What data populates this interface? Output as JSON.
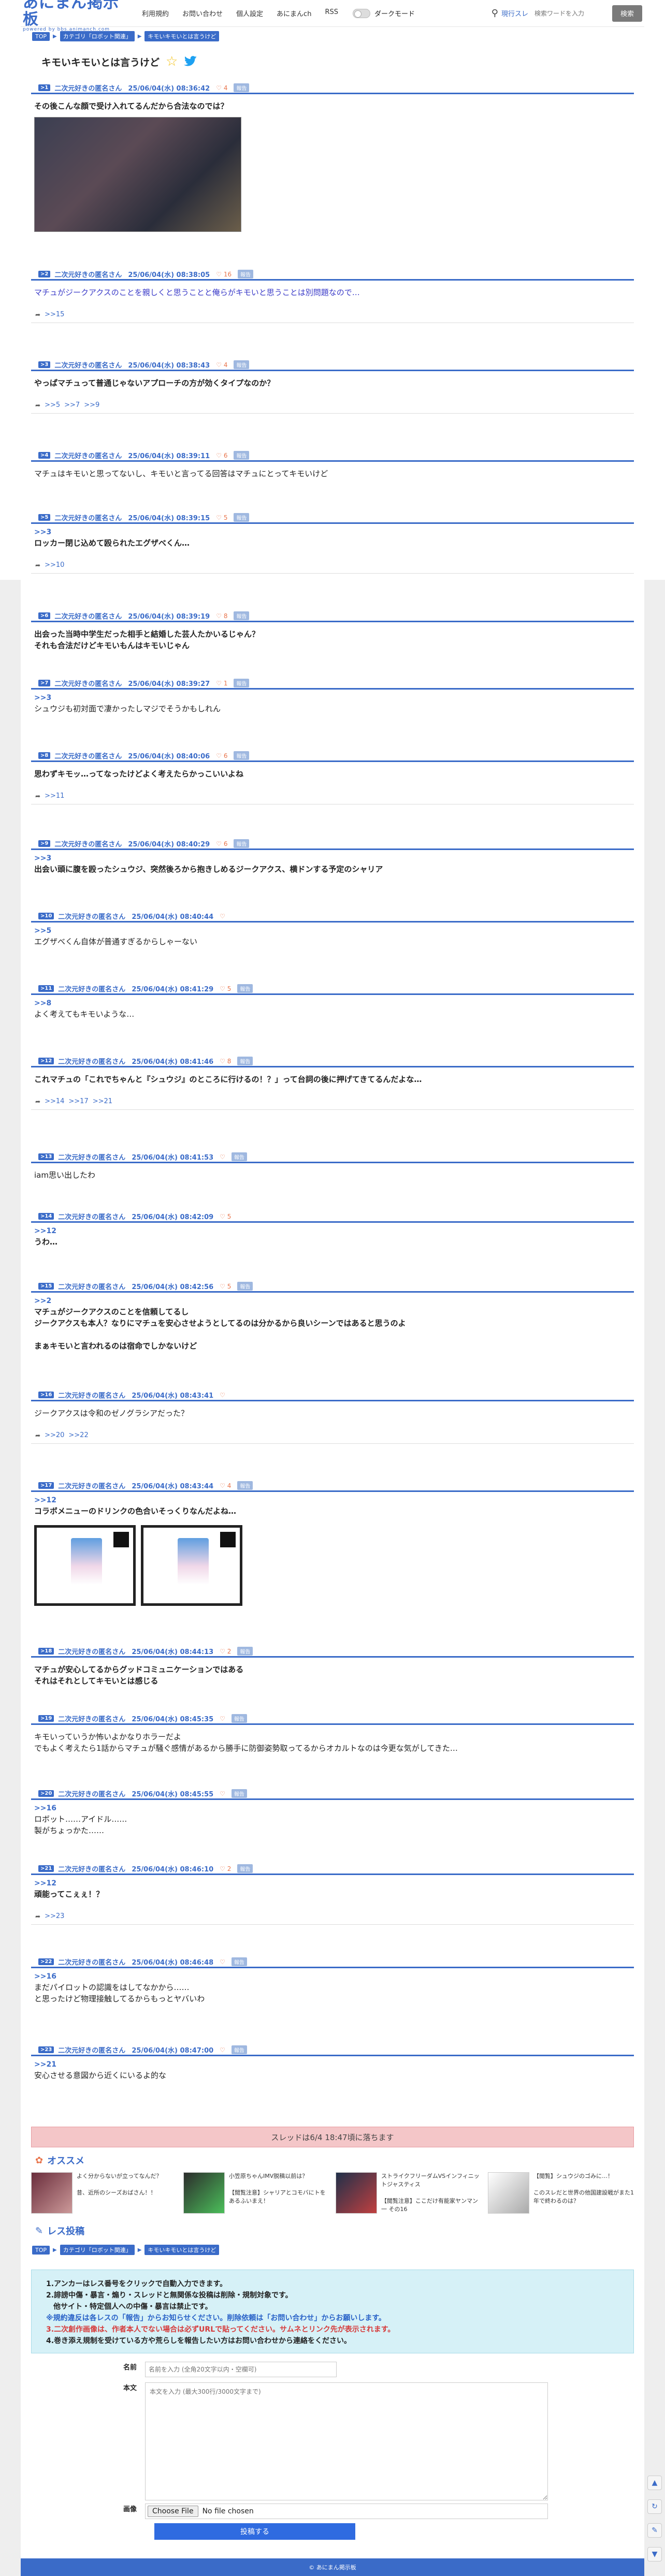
{
  "site": {
    "logo": "あにまん掲示板",
    "logo_sub": "powered by bbs.animanch.com",
    "nav": [
      "利用規約",
      "お問い合わせ",
      "個人設定",
      "あにまんch",
      "RSS"
    ],
    "dark_mode": "ダークモード",
    "search_scope": "現行スレ",
    "search_placeholder": "検索ワードを入力",
    "search_button": "検索"
  },
  "breadcrumb": [
    "TOP",
    "カテゴリ「ロボット関連」",
    "キモいキモいとは言うけど"
  ],
  "thread": {
    "title": "キモいキモいとは言うけど"
  },
  "posts": [
    {
      "num": ">1",
      "name": "二次元好きの匿名さん",
      "date": "25/06/04(水) 08:36:42",
      "likes": "4",
      "report": "報告",
      "body": "その後こんな顔で受け入れてるんだから合法なのでは？",
      "bold": true,
      "has_image": true
    },
    {
      "num": ">2",
      "name": "二次元好きの匿名さん",
      "date": "25/06/04(水) 08:38:05",
      "likes": "16",
      "report": "報告",
      "body": "マチュがジークアクスのことを親しくと思うことと俺らがキモいと思うことは別問題なので…",
      "replies": [
        ">>15"
      ]
    },
    {
      "num": ">3",
      "name": "二次元好きの匿名さん",
      "date": "25/06/04(水) 08:38:43",
      "likes": "4",
      "report": "報告",
      "body": "やっぱマチュって普通じゃないアプローチの方が効くタイプなのか？",
      "bold": true,
      "replies": [
        ">>5",
        ">>7",
        ">>9"
      ]
    },
    {
      "num": ">4",
      "name": "二次元好きの匿名さん",
      "date": "25/06/04(水) 08:39:11",
      "likes": "6",
      "report": "報告",
      "body": "マチュはキモいと思ってないし、キモいと言ってる回答はマチュにとってキモいけど"
    },
    {
      "num": ">5",
      "name": "二次元好きの匿名さん",
      "date": "25/06/04(水) 08:39:15",
      "likes": "5",
      "report": "報告",
      "anchor": ">>3",
      "body": "ロッカー閉じ込めて殴られたエグザべくん…",
      "bold": true,
      "replies": [
        ">>10"
      ]
    },
    {
      "num": ">6",
      "name": "二次元好きの匿名さん",
      "date": "25/06/04(水) 08:39:19",
      "likes": "8",
      "report": "報告",
      "body": "出会った当時中学生だった相手と結婚した芸人たかいるじゃん？\nそれも合法だけどキモいもんはキモいじゃん",
      "bold": true
    },
    {
      "num": ">7",
      "name": "二次元好きの匿名さん",
      "date": "25/06/04(水) 08:39:27",
      "likes": "1",
      "report": "報告",
      "anchor": ">>3",
      "body": "シュウジも初対面で凄かったしマジでそうかもしれん"
    },
    {
      "num": ">8",
      "name": "二次元好きの匿名さん",
      "date": "25/06/04(水) 08:40:06",
      "likes": "6",
      "report": "報告",
      "body": "思わずキモッ…ってなったけどよく考えたらかっこいいよね",
      "bold": true,
      "replies": [
        ">>11"
      ]
    },
    {
      "num": ">9",
      "name": "二次元好きの匿名さん",
      "date": "25/06/04(水) 08:40:29",
      "likes": "6",
      "report": "報告",
      "anchor": ">>3",
      "body": "出会い頭に腹を殴ったシュウジ、突然後ろから抱きしめるジークアクス、横ドンする予定のシャリア",
      "bold": true
    },
    {
      "num": ">10",
      "name": "二次元好きの匿名さん",
      "date": "25/06/04(水) 08:40:44",
      "likes": "",
      "report": "",
      "anchor": ">>5",
      "body": "エグザべくん自体が普通すぎるからしゃーない"
    },
    {
      "num": ">11",
      "name": "二次元好きの匿名さん",
      "date": "25/06/04(水) 08:41:29",
      "likes": "5",
      "report": "報告",
      "anchor": ">>8",
      "body": "よく考えてもキモいような…"
    },
    {
      "num": ">12",
      "name": "二次元好きの匿名さん",
      "date": "25/06/04(水) 08:41:46",
      "likes": "8",
      "report": "報告",
      "body": "これマチュの「これでちゃんと『シュウジ』のところに行けるの！？」って台詞の後に押げてきてるんだよな…",
      "bold": true,
      "replies": [
        ">>14",
        ">>17",
        ">>21"
      ]
    },
    {
      "num": ">13",
      "name": "二次元好きの匿名さん",
      "date": "25/06/04(水) 08:41:53",
      "likes": "",
      "report": "報告",
      "body": "iam思い出したわ"
    },
    {
      "num": ">14",
      "name": "二次元好きの匿名さん",
      "date": "25/06/04(水) 08:42:09",
      "likes": "5",
      "report": "",
      "anchor": ">>12",
      "body": "うわ…",
      "bold": true
    },
    {
      "num": ">15",
      "name": "二次元好きの匿名さん",
      "date": "25/06/04(水) 08:42:56",
      "likes": "5",
      "report": "報告",
      "anchor": ">>2",
      "body": "マチュがジークアクスのことを信頼してるし\nジークアクスも本人？なりにマチュを安心させようとしてるのは分かるから良いシーンではあると思うのよ\n\nまぁキモいと言われるのは宿命でしかないけど",
      "bold": true
    },
    {
      "num": ">16",
      "name": "二次元好きの匿名さん",
      "date": "25/06/04(水) 08:43:41",
      "likes": "",
      "report": "",
      "body": "ジークアクスは令和のゼノグラシアだった？",
      "replies": [
        ">>20",
        ">>22"
      ]
    },
    {
      "num": ">17",
      "name": "二次元好きの匿名さん",
      "date": "25/06/04(水) 08:43:44",
      "likes": "4",
      "report": "報告",
      "anchor": ">>12",
      "body": "コラボメニューのドリンクの色合いそっくりなんだよね…",
      "bold": true,
      "has_drinks": true
    },
    {
      "num": ">18",
      "name": "二次元好きの匿名さん",
      "date": "25/06/04(水) 08:44:13",
      "likes": "2",
      "report": "報告",
      "body": "マチュが安心してるからグッドコミュニケーションではある\nそれはそれとしてキモいとは感じる",
      "bold": true
    },
    {
      "num": ">19",
      "name": "二次元好きの匿名さん",
      "date": "25/06/04(水) 08:45:35",
      "likes": "",
      "report": "報告",
      "body": "キモいっていうか怖いよかなりホラーだよ\nでもよく考えたら1話からマチュが騒ぐ感情があるから勝手に防御姿勢取ってるからオカルトなのは今更な気がしてきた…"
    },
    {
      "num": ">20",
      "name": "二次元好きの匿名さん",
      "date": "25/06/04(水) 08:45:55",
      "likes": "",
      "report": "報告",
      "anchor": ">>16",
      "body": "ロボット……アイドル……\n製がちょっかた……"
    },
    {
      "num": ">21",
      "name": "二次元好きの匿名さん",
      "date": "25/06/04(水) 08:46:10",
      "likes": "2",
      "report": "報告",
      "anchor": ">>12",
      "body": "頑能ってこぇぇ！？",
      "bold": true,
      "replies": [
        ">>23"
      ]
    },
    {
      "num": ">22",
      "name": "二次元好きの匿名さん",
      "date": "25/06/04(水) 08:46:48",
      "likes": "",
      "report": "報告",
      "anchor": ">>16",
      "body": "まだパイロットの認識をはしてなかから……\nと思ったけど物理接触してるからもっとヤバいわ"
    },
    {
      "num": ">23",
      "name": "二次元好きの匿名さん",
      "date": "25/06/04(水) 08:47:00",
      "likes": "",
      "report": "報告",
      "anchor": ">>21",
      "body": "安心させる意図から近くにいるよ的な"
    }
  ],
  "closing_notice": "スレッドは6/4 18:47頃に落ちます",
  "recommend": {
    "title": "オススメ",
    "items": [
      {
        "text": "よく分からないが立ってなんだ？\n\n昔、近所のシーズおばさん！！"
      },
      {
        "text": "小笠原ちゃんIMV脱稿以前は？\n\n【閲覧注意】シャリアとコモバにトをあるふいまえ！"
      },
      {
        "text": "ストライクフリーダムVSインフィニットジャスティス\n\n【閲覧注意】ここだけ有能家ヤンマン一 その16"
      },
      {
        "text": "【閲覧】シュウジのゴみに…！\n\nこのスレだと世界の他国建設戦がまた1年で終わるのは？"
      }
    ]
  },
  "reply_section": {
    "title": "レス投稿",
    "rules": [
      "1.アンカーはレス番号をクリックで自動入力できます。",
      "2.誹謗中傷・暴言・煽り・スレッドと無関係な投稿は削除・規制対象です。",
      "　他サイト・特定個人への中傷・暴言は禁止です。",
      "※規約違反は各レスの「報告」からお知らせください。削除依頼は「お問い合わせ」からお願いします。",
      "3.二次創作画像は、作者本人でない場合は必ずURLで貼ってください。サムネとリンク先が表示されます。",
      "4.巻き添え規制を受けている方や荒らしを報告したい方はお問い合わせから連絡をください。"
    ],
    "name_label": "名前",
    "name_placeholder": "名前を入力 (全角20文字以内・空欄可)",
    "body_label": "本文",
    "body_placeholder": "本文を入力 (最大300行/3000文字まで)",
    "image_label": "画像",
    "file_button": "Choose File",
    "file_status": "No file chosen",
    "submit": "投稿する"
  },
  "footer": "© あにまん掲示板"
}
